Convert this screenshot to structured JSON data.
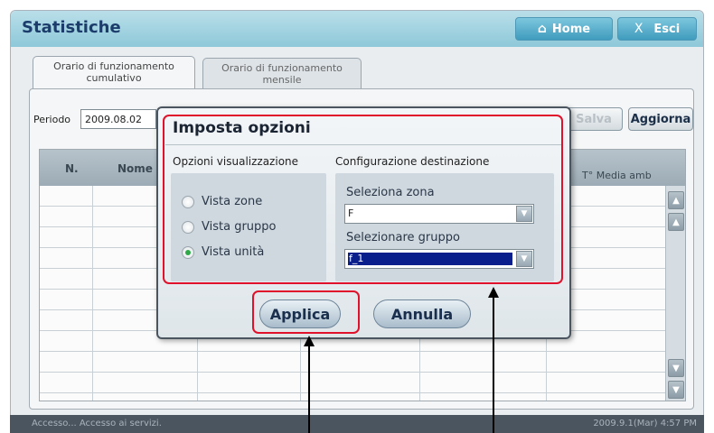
{
  "header": {
    "title": "Statistiche",
    "home_label": "Home",
    "exit_label": "Esci",
    "exit_glyph": "X"
  },
  "tabs": [
    {
      "line1": "Orario di funzionamento",
      "line2": "cumulativo"
    },
    {
      "line1": "Orario di funzionamento",
      "line2": "mensile"
    }
  ],
  "toolbar": {
    "period_label": "Periodo",
    "period_value": "2009.08.02",
    "save_label": "Salva",
    "refresh_label": "Aggiorna"
  },
  "table": {
    "columns": [
      "N.",
      "Nome u",
      "T° Media amb"
    ]
  },
  "dialog": {
    "title": "Imposta opzioni",
    "view_section_label": "Opzioni visualizzazione",
    "view_options": [
      "Vista zone",
      "Vista gruppo",
      "Vista unità"
    ],
    "selected_view": "Vista unità",
    "dest_section_label": "Configurazione destinazione",
    "zone_label": "Seleziona zona",
    "zone_value": "F",
    "group_label": "Selezionare gruppo",
    "group_value": "f_1",
    "apply_label": "Applica",
    "cancel_label": "Annulla"
  },
  "status": {
    "left": "Accesso... Accesso ai servizi.",
    "right": "2009.9.1(Mar)  4:57 PM"
  },
  "colors": {
    "highlight_red": "#e0112b",
    "title_blue": "#1c3d6c",
    "selected_radio": "#2fa84a"
  }
}
